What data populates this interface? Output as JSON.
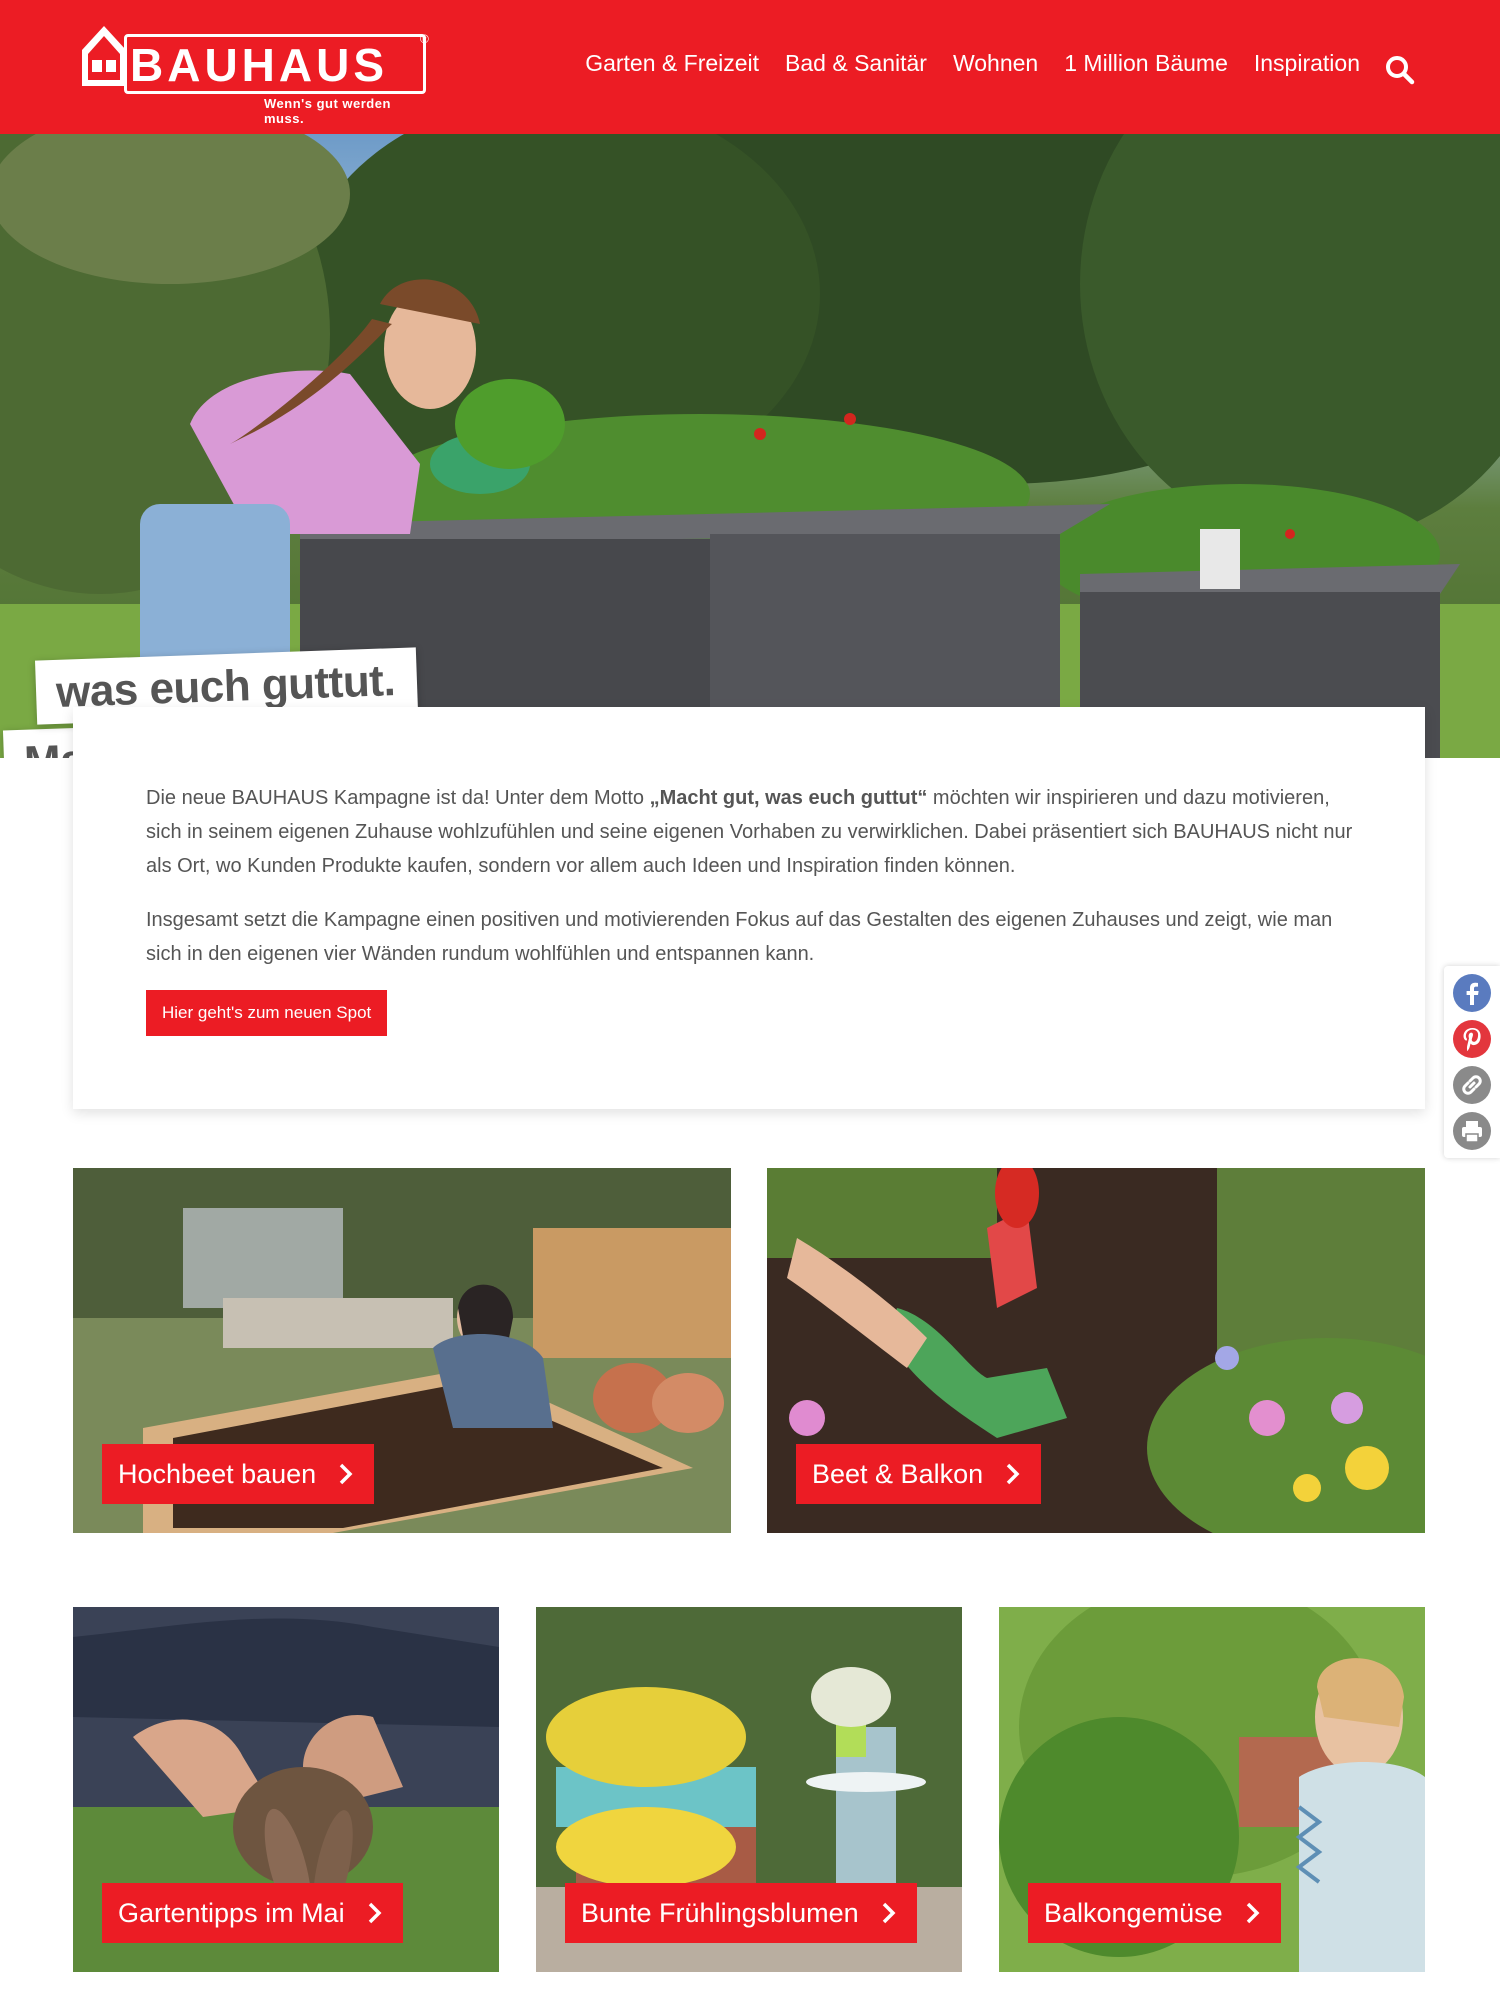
{
  "brand": {
    "name": "BAUHAUS",
    "tagline": "Wenn's gut werden muss.",
    "reg": "®",
    "color": "#ec1c24"
  },
  "nav": {
    "items": [
      {
        "label": "Garten & Freizeit"
      },
      {
        "label": "Bad & Sanitär"
      },
      {
        "label": "Wohnen"
      },
      {
        "label": "1 Million Bäume"
      },
      {
        "label": "Inspiration"
      }
    ],
    "search_icon": "search-icon"
  },
  "hero": {
    "slogan_line1": "Macht gut,",
    "slogan_line2": "was euch guttut."
  },
  "intro": {
    "para1_before": "Die neue BAUHAUS Kampagne ist da! Unter dem Motto ",
    "para1_bold": "„Macht gut, was euch guttut“",
    "para1_after": " möchten wir inspirieren und dazu motivieren, sich in seinem eigenen Zuhause wohlzufühlen und seine eigenen Vorhaben zu verwirklichen. Dabei präsentiert sich BAUHAUS nicht nur als Ort, wo Kunden Produkte kaufen, sondern vor allem auch Ideen und Inspiration finden können.",
    "para2": "Insgesamt setzt die Kampagne einen positiven und motivierenden Fokus auf das Gestalten des eigenen Zuhauses und zeigt, wie man sich in den eigenen vier Wänden rundum wohlfühlen und entspannen kann.",
    "cta_label": "Hier geht's zum neuen Spot"
  },
  "social": {
    "icons": [
      "facebook-icon",
      "pinterest-icon",
      "link-icon",
      "print-icon"
    ]
  },
  "tiles": [
    {
      "label": "Hochbeet bauen"
    },
    {
      "label": "Beet & Balkon"
    },
    {
      "label": "Gartentipps im Mai"
    },
    {
      "label": "Bunte Frühlingsblumen"
    },
    {
      "label": "Balkongemüse"
    }
  ]
}
